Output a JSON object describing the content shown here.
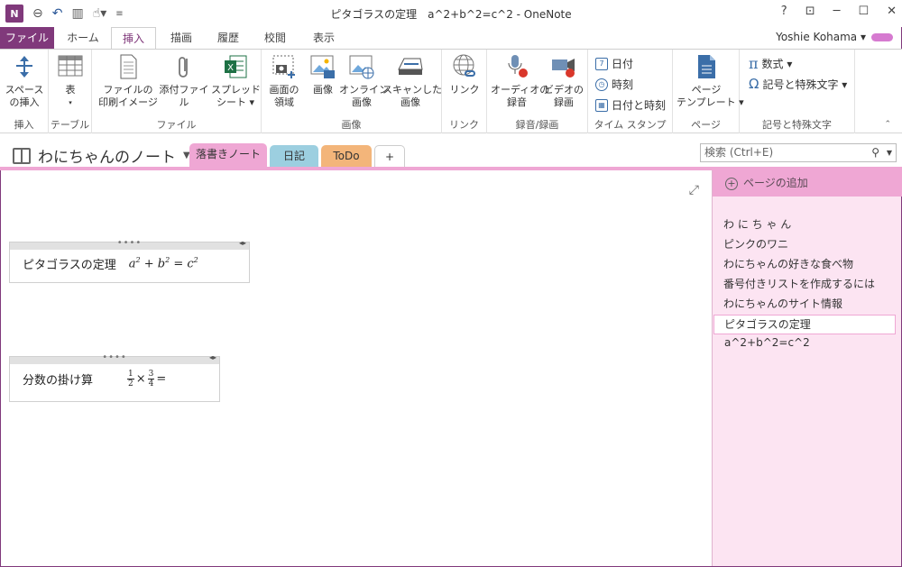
{
  "window": {
    "title": "ピタゴラスの定理　a^2+b^2=c^2 - OneNote",
    "controls": [
      "?",
      "⊡",
      "─",
      "☐",
      "✕"
    ]
  },
  "qat": {
    "logo": "N"
  },
  "ribbon_tabs": {
    "file": "ファイル",
    "items": [
      "ホーム",
      "挿入",
      "描画",
      "履歴",
      "校閲",
      "表示"
    ],
    "active": "挿入"
  },
  "user": {
    "name": "Yoshie Kohama ▾"
  },
  "ribbon": {
    "insert_group": {
      "label": "挿入",
      "space_btn": "スペース\nの挿入"
    },
    "table_group": {
      "label": "テーブル",
      "table_btn": "表"
    },
    "file_group": {
      "label": "ファイル",
      "printout_btn": "ファイルの\n印刷イメージ",
      "attach_btn": "添付ファイル",
      "spreadsheet_btn": "スプレッド\nシート ▾"
    },
    "image_group": {
      "label": "画像",
      "screen_btn": "画面の\n領域",
      "picture_btn": "画像",
      "online_btn": "オンライン\n画像",
      "scan_btn": "スキャンした\n画像"
    },
    "link_group": {
      "label": "リンク",
      "link_btn": "リンク"
    },
    "media_group": {
      "label": "録音/録画",
      "audio_btn": "オーディオの\n録音",
      "video_btn": "ビデオの\n録画"
    },
    "time_group": {
      "label": "タイム スタンプ",
      "date": "日付",
      "time": "時刻",
      "datetime": "日付と時刻"
    },
    "page_group": {
      "label": "ページ",
      "template_btn": "ページ\nテンプレート ▾"
    },
    "symbol_group": {
      "label": "記号と特殊文字",
      "equation": "数式 ▾",
      "symbol": "記号と特殊文字 ▾"
    }
  },
  "notebook": {
    "name": "わにちゃんのノート",
    "sections": [
      {
        "label": "落書きノート",
        "color": "#EFA7D4"
      },
      {
        "label": "日記",
        "color": "#9CCFE0"
      },
      {
        "label": "ToDo",
        "color": "#F3B57A"
      }
    ],
    "add_section": "+"
  },
  "search": {
    "placeholder": "検索 (Ctrl+E)"
  },
  "notes": [
    {
      "label": "ピタゴラスの定理"
    },
    {
      "label": "分数の掛け算",
      "frac1": [
        "1",
        "2"
      ],
      "frac2": [
        "3",
        "4"
      ]
    }
  ],
  "pages": {
    "add_label": "ページの追加",
    "items": [
      "わ に ち ゃ ん",
      "ピンクのワニ",
      "わにちゃんの好きな食べ物",
      "番号付きリストを作成するには",
      "わにちゃんのサイト情報"
    ],
    "selected": "ピタゴラスの定理　a^2+b^2=c^2"
  }
}
